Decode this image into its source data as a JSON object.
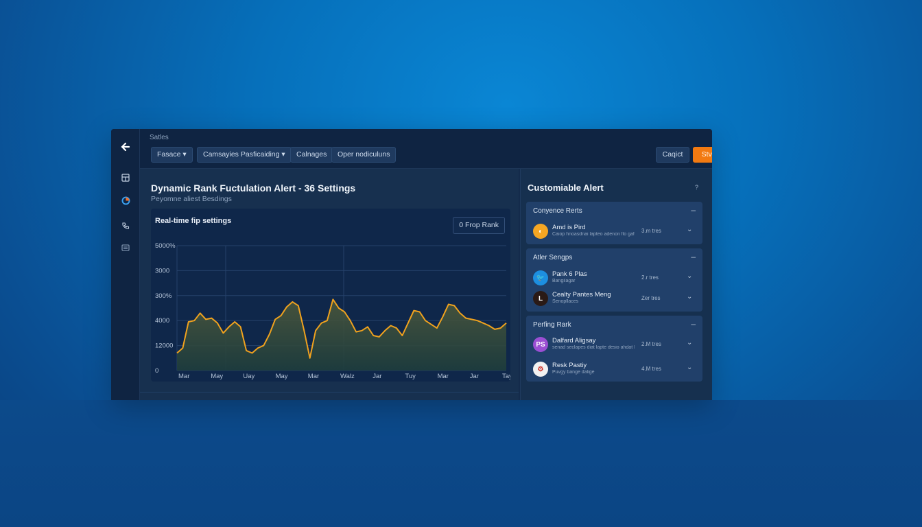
{
  "topbar": {
    "breadcrumb": "Satles",
    "tabs": [
      "Fasace ▾",
      "Camsayies  Pasficaiding ▾",
      "Calnages",
      "Oper nodiculuns"
    ],
    "cancel_label": "Caqict",
    "save_label": "Stvrts"
  },
  "main": {
    "title": "Dynamic Rank Fuctulation Alert - 36 Settings",
    "subtitle": "Peyomne aliest Besdings",
    "chart_card_title": "Real-time fip settings",
    "chart_button": "0 Frop Rank"
  },
  "chart_data": {
    "type": "area",
    "y_tick_labels": [
      "0",
      "12000",
      "4000",
      "300%",
      "3000",
      "5000%"
    ],
    "x_tick_labels": [
      "Mar",
      "May",
      "Uay",
      "May",
      "Mar",
      "Walz",
      "Jar",
      "Tuy",
      "Mar",
      "Jar",
      "Tay"
    ],
    "ylim": [
      0,
      5000
    ],
    "grid": true,
    "values": [
      700,
      900,
      1950,
      2000,
      2300,
      2050,
      2100,
      1900,
      1500,
      1750,
      1950,
      1750,
      800,
      700,
      900,
      1000,
      1450,
      2050,
      2200,
      2550,
      2750,
      2600,
      1600,
      500,
      1600,
      1900,
      2000,
      2850,
      2500,
      2350,
      2000,
      1550,
      1600,
      1750,
      1400,
      1350,
      1600,
      1800,
      1700,
      1400,
      1900,
      2400,
      2350,
      2000,
      1850,
      1700,
      2150,
      2650,
      2600,
      2300,
      2100,
      2050,
      2000,
      1900,
      1800,
      1650,
      1700,
      1900
    ],
    "series_color": "#f0a21e"
  },
  "sidebar": {
    "title": "Customiable Alert",
    "help": "?",
    "groups": [
      {
        "header": "Conyence Rerts",
        "items": [
          {
            "name": "Amd is Pird",
            "desc": "Caiop hnoasdnai lapteo adenon flo gafys...",
            "time": "3.m tres",
            "avatar_text": "◐",
            "avatar_color": "#f5a623"
          }
        ]
      },
      {
        "header": "Atler Sengps",
        "items": [
          {
            "name": "Pank 6 Plas",
            "desc": "Bangilagar",
            "time": "2.r tres",
            "avatar_text": "🐦",
            "avatar_color": "#1d8fe0"
          },
          {
            "name": "Cealty Pantes Meng",
            "desc": "Senopllaces",
            "time": "Zer tres",
            "avatar_text": "L",
            "avatar_color": "#2a1a16"
          }
        ]
      },
      {
        "header": "Perfing Rark",
        "items": [
          {
            "name": "Dalfard Aligsay",
            "desc": "senad seclapes diat lapte desio ahdat ldesipe Cesgap sanap...",
            "time": "2.M tres",
            "avatar_text": "PS",
            "avatar_color": "#9b4fd3"
          },
          {
            "name": "Resk Pastiy",
            "desc": "Puvgy bange dalige",
            "time": "4.M tres",
            "avatar_text": "⚙",
            "avatar_color": "#f2f2f2"
          }
        ]
      }
    ]
  }
}
